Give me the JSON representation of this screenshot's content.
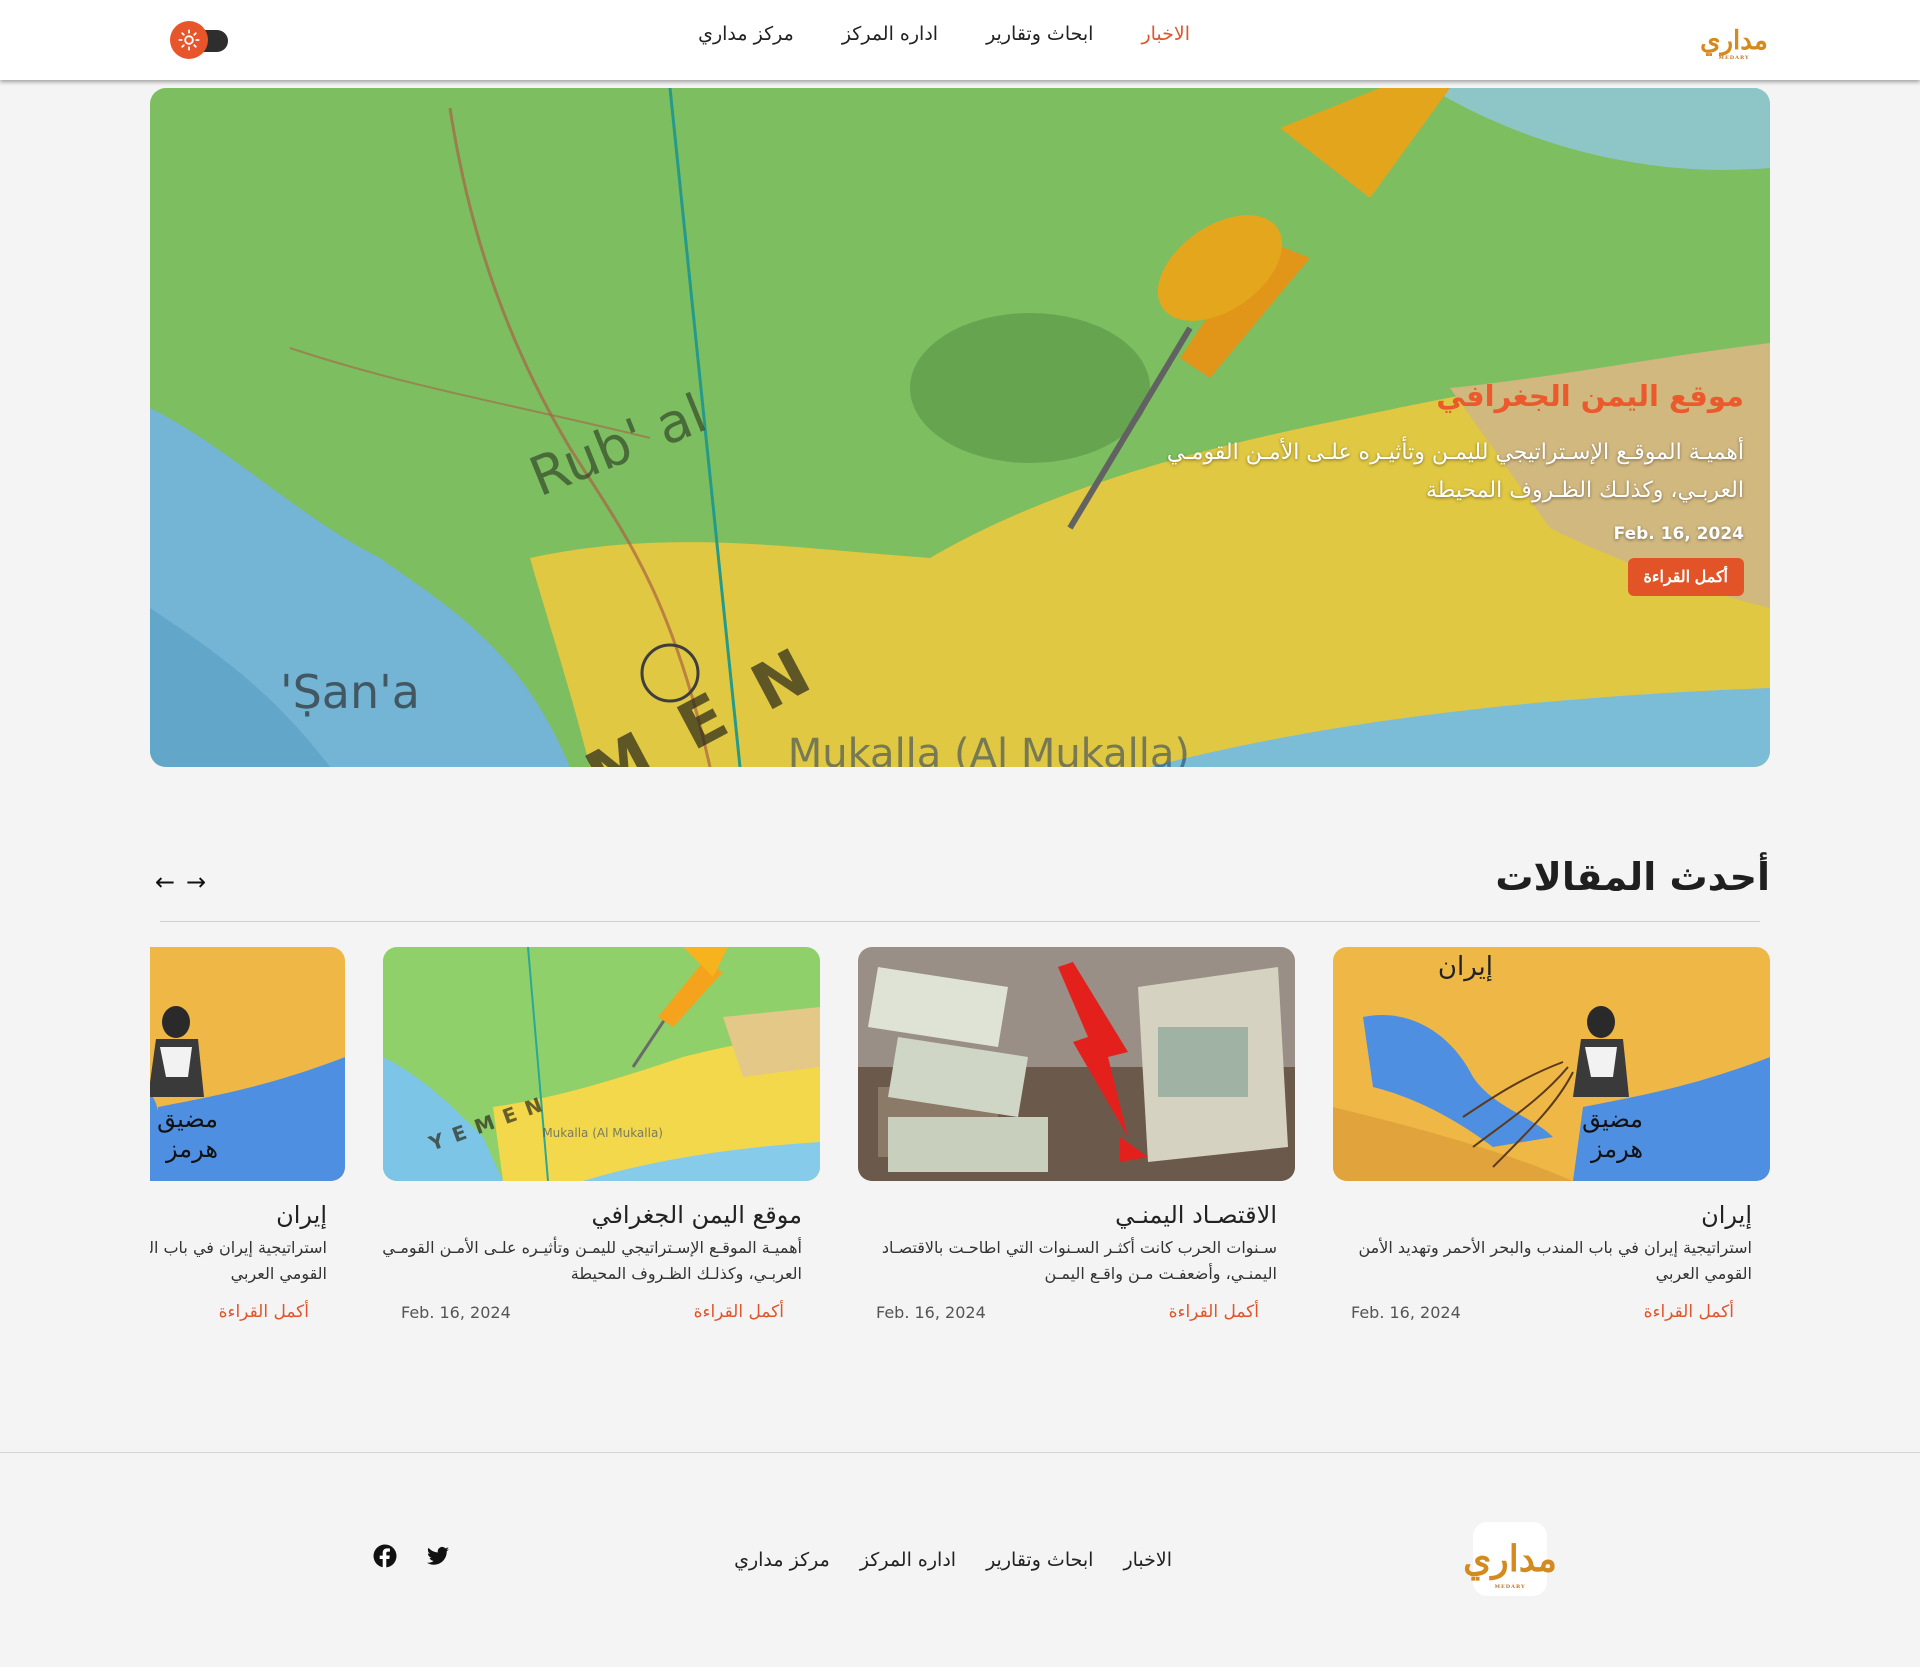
{
  "header": {
    "logo_text": "مداري",
    "logo_sub": "MEDARY",
    "nav": [
      {
        "label": "الاخبار",
        "active": true
      },
      {
        "label": "ابحاث وتقارير",
        "active": false
      },
      {
        "label": "اداره المركز",
        "active": false
      },
      {
        "label": "مركز مداري",
        "active": false
      }
    ],
    "theme_icon": "sun-icon"
  },
  "hero": {
    "title": "موقع اليمن الجغرافي",
    "description": "أهميـة الموقـع الإسـتراتيجي لليمـن وتأثيـره علـى الأمـن القومـي العربـي، وكذلـك الظـروف المحيطة",
    "date": "Feb. 16, 2024",
    "button": "أكمل القراءة"
  },
  "latest": {
    "title": "أحدث المقالات",
    "prev_icon": "arrow-left-icon",
    "next_icon": "arrow-right-icon",
    "cards": [
      {
        "title": "إيران",
        "description": "استراتيجية إيران في باب المندب والبحر الأحمر وتهديد الأمن القومي العربي",
        "date": "Feb. 16, 2024",
        "more": "أكمل القراءة",
        "image": "iran-strait-cartoon"
      },
      {
        "title": "الاقتصـاد اليمنـي",
        "description": "سـنوات الحرب كانت أكثـر السـنوات التي اطاحـت بالاقتصـاد اليمنـي، وأضعفـت مـن واقـع اليمـن",
        "date": "Feb. 16, 2024",
        "more": "أكمل القراءة",
        "image": "currency-collapse"
      },
      {
        "title": "موقع اليمن الجغرافي",
        "description": "أهميـة الموقـع الإسـتراتيجي لليمـن وتأثيـره علـى الأمـن القومـي العربـي، وكذلـك الظـروف المحيطة",
        "date": "Feb. 16, 2024",
        "more": "أكمل القراءة",
        "image": "yemen-map-pin"
      },
      {
        "title": "إيران",
        "description": "استراتيجية إيران في باب المندب والبحر الأحمر وتهديد الأمن القومي العربي",
        "date": "",
        "more": "أكمل القراءة",
        "image": "iran-strait-cartoon"
      }
    ]
  },
  "footer": {
    "logo_text": "مداري",
    "logo_sub": "MEDARY",
    "nav": [
      "الاخبار",
      "ابحاث وتقارير",
      "اداره المركز",
      "مركز مداري"
    ],
    "social": [
      "twitter-icon",
      "facebook-icon"
    ]
  },
  "colors": {
    "accent": "#e0552c",
    "map_green": "#8fd46a",
    "map_yellow": "#f6d84a",
    "sea_blue": "#7cc6ea"
  }
}
